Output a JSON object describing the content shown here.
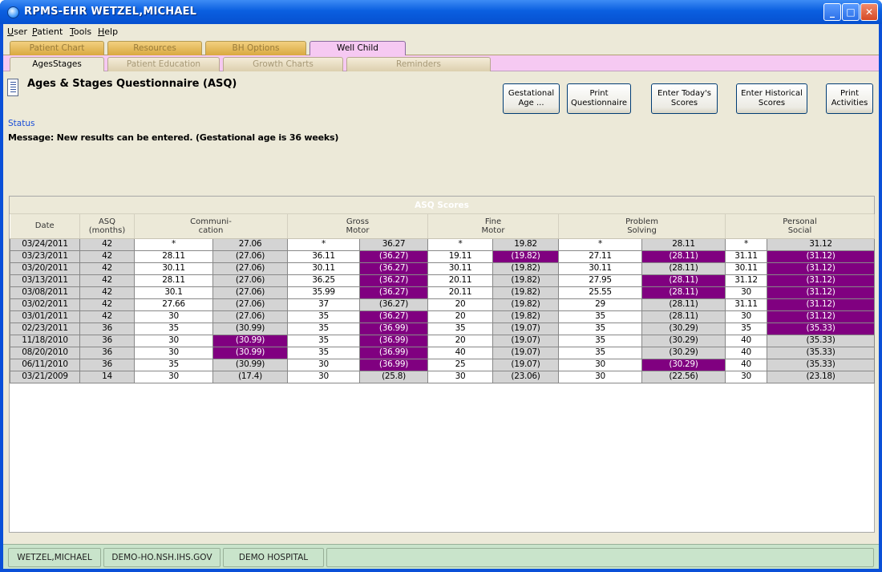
{
  "window": {
    "title": "RPMS-EHR WETZEL,MICHAEL",
    "minimize": "_",
    "maximize": "□",
    "close": "✕"
  },
  "menu": [
    "User",
    "Patient",
    "Tools",
    "Help"
  ],
  "main_tabs": [
    "Patient Chart",
    "Resources",
    "BH Options",
    "Well Child"
  ],
  "sub_tabs": [
    "AgesStages",
    "Patient Education",
    "Growth Charts",
    "Reminders"
  ],
  "panel": {
    "title": "Ages & Stages Questionnaire (ASQ)",
    "status_label": "Status",
    "message": "Message:  New results can be entered.  (Gestational age is 36 weeks)"
  },
  "buttons": {
    "gestational": "Gestational\nAge ...",
    "print_q": "Print\nQuestionnaire",
    "enter_today": "Enter Today's\nScores",
    "enter_hist": "Enter Historical\nScores",
    "print_act": "Print\nActivities"
  },
  "table": {
    "caption": "ASQ Scores",
    "headers": {
      "date": "Date",
      "asq": "ASQ\n(months)",
      "comm": "Communi-\ncation",
      "gross": "Gross\nMotor",
      "fine": "Fine\nMotor",
      "problem": "Problem\nSolving",
      "personal": "Personal\nSocial"
    },
    "rows": [
      {
        "date": "03/24/2011",
        "asq": "42",
        "v": [
          "*",
          "27.06",
          "*",
          "36.27",
          "*",
          "19.82",
          "*",
          "28.11",
          "*",
          "31.12"
        ],
        "p": []
      },
      {
        "date": "03/23/2011",
        "asq": "42",
        "v": [
          "28.11",
          "(27.06)",
          "36.11",
          "(36.27)",
          "19.11",
          "(19.82)",
          "27.11",
          "(28.11)",
          "31.11",
          "(31.12)"
        ],
        "p": [
          3,
          5,
          7,
          9
        ]
      },
      {
        "date": "03/20/2011",
        "asq": "42",
        "v": [
          "30.11",
          "(27.06)",
          "30.11",
          "(36.27)",
          "30.11",
          "(19.82)",
          "30.11",
          "(28.11)",
          "30.11",
          "(31.12)"
        ],
        "p": [
          3,
          9
        ]
      },
      {
        "date": "03/13/2011",
        "asq": "42",
        "v": [
          "28.11",
          "(27.06)",
          "36.25",
          "(36.27)",
          "20.11",
          "(19.82)",
          "27.95",
          "(28.11)",
          "31.12",
          "(31.12)"
        ],
        "p": [
          3,
          7,
          9
        ]
      },
      {
        "date": "03/08/2011",
        "asq": "42",
        "v": [
          "30.1",
          "(27.06)",
          "35.99",
          "(36.27)",
          "20.11",
          "(19.82)",
          "25.55",
          "(28.11)",
          "30",
          "(31.12)"
        ],
        "p": [
          3,
          7,
          9
        ]
      },
      {
        "date": "03/02/2011",
        "asq": "42",
        "v": [
          "27.66",
          "(27.06)",
          "37",
          "(36.27)",
          "20",
          "(19.82)",
          "29",
          "(28.11)",
          "31.11",
          "(31.12)"
        ],
        "p": [
          9
        ]
      },
      {
        "date": "03/01/2011",
        "asq": "42",
        "v": [
          "30",
          "(27.06)",
          "35",
          "(36.27)",
          "20",
          "(19.82)",
          "35",
          "(28.11)",
          "30",
          "(31.12)"
        ],
        "p": [
          3,
          9
        ]
      },
      {
        "date": "02/23/2011",
        "asq": "36",
        "v": [
          "35",
          "(30.99)",
          "35",
          "(36.99)",
          "35",
          "(19.07)",
          "35",
          "(30.29)",
          "35",
          "(35.33)"
        ],
        "p": [
          3,
          9
        ]
      },
      {
        "date": "11/18/2010",
        "asq": "36",
        "v": [
          "30",
          "(30.99)",
          "35",
          "(36.99)",
          "20",
          "(19.07)",
          "35",
          "(30.29)",
          "40",
          "(35.33)"
        ],
        "p": [
          1,
          3
        ]
      },
      {
        "date": "08/20/2010",
        "asq": "36",
        "v": [
          "30",
          "(30.99)",
          "35",
          "(36.99)",
          "40",
          "(19.07)",
          "35",
          "(30.29)",
          "40",
          "(35.33)"
        ],
        "p": [
          1,
          3
        ]
      },
      {
        "date": "06/11/2010",
        "asq": "36",
        "v": [
          "35",
          "(30.99)",
          "30",
          "(36.99)",
          "25",
          "(19.07)",
          "30",
          "(30.29)",
          "40",
          "(35.33)"
        ],
        "p": [
          3,
          7
        ]
      },
      {
        "date": "03/21/2009",
        "asq": "14",
        "v": [
          "30",
          "(17.4)",
          "30",
          "(25.8)",
          "30",
          "(23.06)",
          "30",
          "(22.56)",
          "30",
          "(23.18)"
        ],
        "p": []
      }
    ]
  },
  "statusbar": [
    "WETZEL,MICHAEL",
    "DEMO-HO.NSH.IHS.GOV",
    "DEMO HOSPITAL"
  ],
  "colors": {
    "purple": "#800080",
    "pink_tab": "#f6c9f2",
    "status_green": "#c9e4cb",
    "title_blue": "#0a5fe0"
  }
}
